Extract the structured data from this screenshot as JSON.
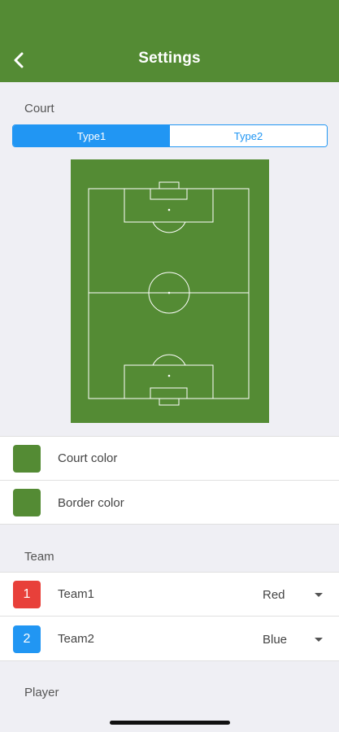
{
  "header": {
    "title": "Settings",
    "back_icon": "chevron-left-icon",
    "background": "#548b34"
  },
  "court": {
    "section_label": "Court",
    "types": [
      {
        "label": "Type1",
        "selected": true
      },
      {
        "label": "Type2",
        "selected": false
      }
    ],
    "field_color": "#548b34",
    "court_color_label": "Court color",
    "court_color": "#548b34",
    "border_color_label": "Border color",
    "border_color": "#548b34"
  },
  "team": {
    "section_label": "Team",
    "teams": [
      {
        "number": "1",
        "name": "Team1",
        "color_value": "Red",
        "badge_color": "#e8403a"
      },
      {
        "number": "2",
        "name": "Team2",
        "color_value": "Blue",
        "badge_color": "#2196f3"
      }
    ]
  },
  "player": {
    "section_label": "Player"
  },
  "accent_color": "#2196f3"
}
